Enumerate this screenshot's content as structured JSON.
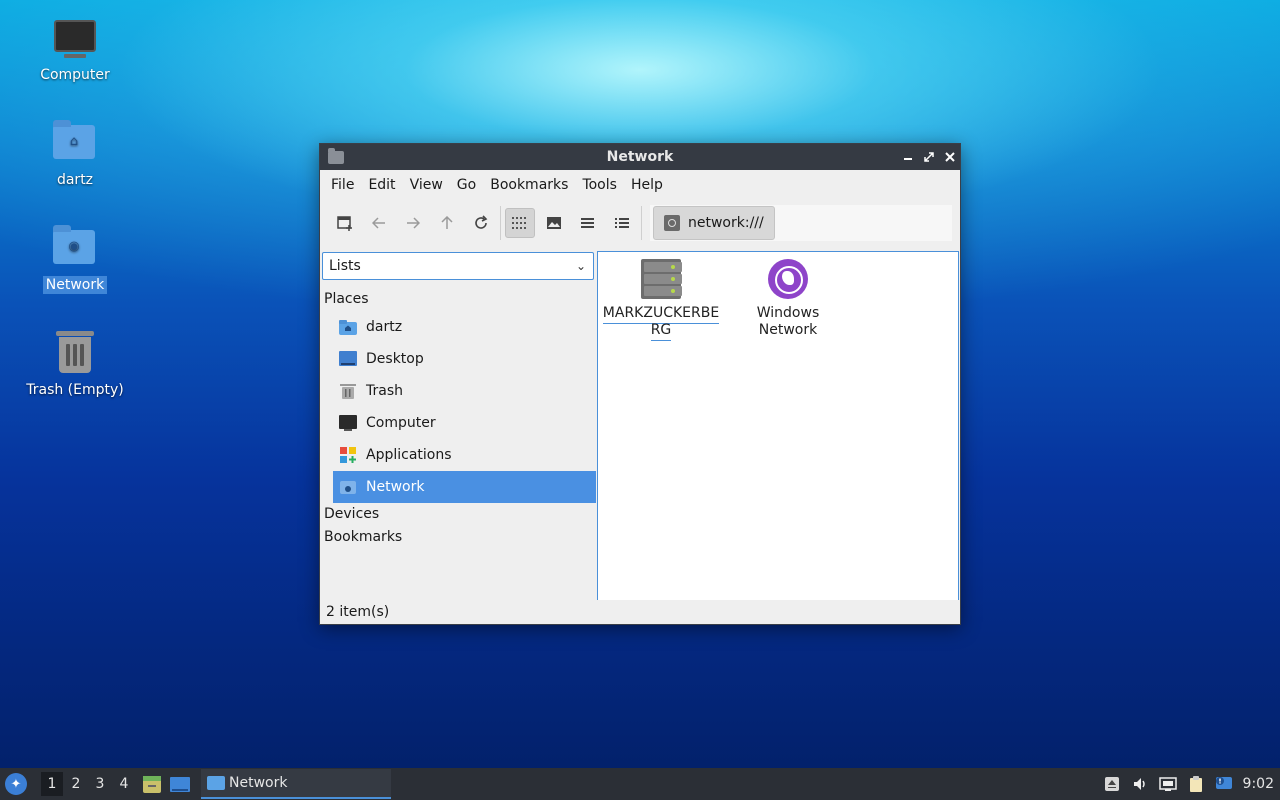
{
  "desktop": {
    "icons": [
      {
        "label": "Computer",
        "icon": "computer-icon"
      },
      {
        "label": "dartz",
        "icon": "home-folder-icon"
      },
      {
        "label": "Network",
        "icon": "network-folder-icon",
        "selected": true
      },
      {
        "label": "Trash (Empty)",
        "icon": "trash-icon"
      }
    ]
  },
  "window": {
    "title": "Network",
    "controls": [
      "minimize",
      "maximize",
      "close"
    ],
    "menu": [
      "File",
      "Edit",
      "View",
      "Go",
      "Bookmarks",
      "Tools",
      "Help"
    ],
    "toolbar": {
      "buttons": [
        "new-tab",
        "back",
        "forward",
        "up",
        "reload",
        "icon-view",
        "thumbnail-view",
        "compact-view",
        "detailed-list-view"
      ],
      "active_view": "icon-view"
    },
    "path": "network:///",
    "side_pane": {
      "mode": "Lists",
      "places_header": "Places",
      "places": [
        {
          "label": "dartz",
          "icon": "home-folder-icon"
        },
        {
          "label": "Desktop",
          "icon": "desktop-icon"
        },
        {
          "label": "Trash",
          "icon": "trash-icon"
        },
        {
          "label": "Computer",
          "icon": "computer-icon"
        },
        {
          "label": "Applications",
          "icon": "applications-icon"
        },
        {
          "label": "Network",
          "icon": "network-icon",
          "selected": true
        }
      ],
      "devices_header": "Devices",
      "bookmarks_header": "Bookmarks"
    },
    "items": [
      {
        "label": "MARKZUCKERBERG",
        "label_line1": "MARKZUCKERBE",
        "label_line2": "RG",
        "icon": "server-icon"
      },
      {
        "label": "Windows Network",
        "label_line1": "Windows",
        "label_line2": "Network",
        "icon": "windows-network-icon"
      }
    ],
    "status": "2 item(s)"
  },
  "taskbar": {
    "workspaces": [
      "1",
      "2",
      "3",
      "4"
    ],
    "current_workspace": "1",
    "task_label": "Network",
    "clock": "9:02"
  }
}
